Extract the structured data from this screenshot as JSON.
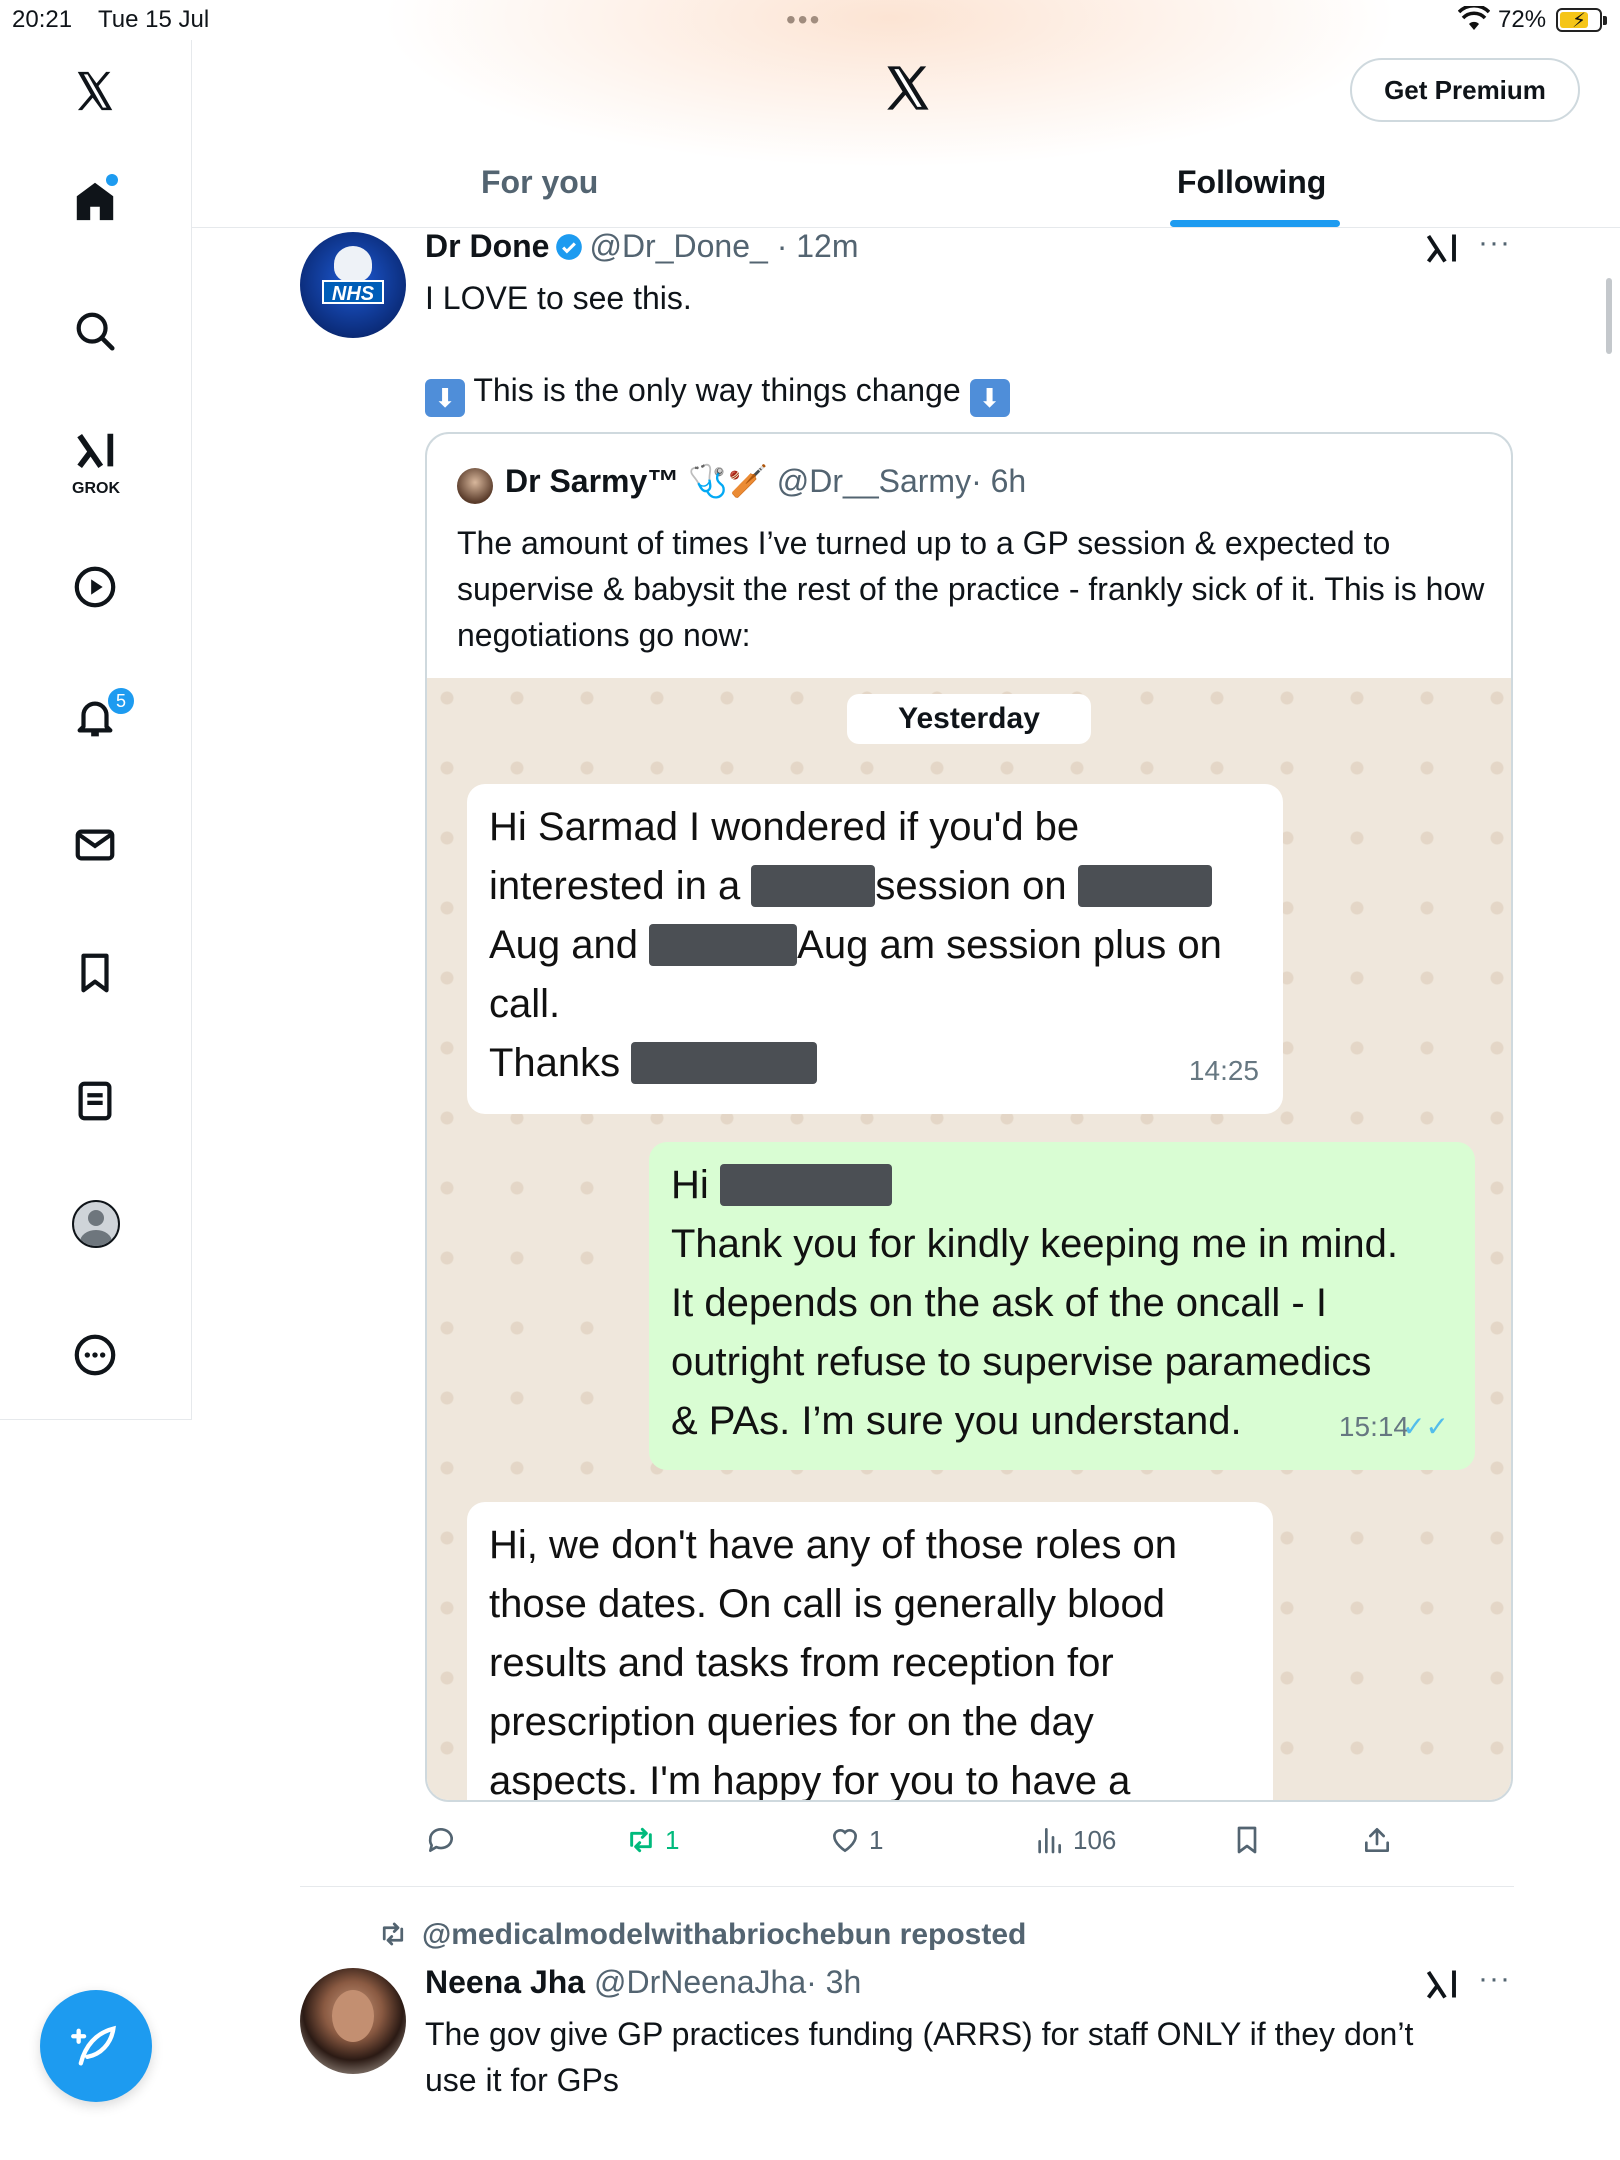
{
  "status_bar": {
    "time": "20:21",
    "date": "Tue 15 Jul",
    "battery": "72%"
  },
  "header": {
    "get_premium": "Get Premium",
    "tabs": [
      "For you",
      "Following"
    ],
    "active_tab": "Following"
  },
  "sidebar": {
    "items": [
      "home-icon",
      "search-icon",
      "grok-icon",
      "video-icon",
      "bell-icon",
      "mail-icon",
      "bookmark-icon",
      "lists-icon",
      "profile-icon",
      "more-icon"
    ],
    "grok_label": "GROK",
    "notification_count": "5"
  },
  "tweet1": {
    "name": "Dr Done",
    "handle": "@Dr_Done_",
    "time": "· 12m",
    "line1": "I LOVE to see this.",
    "line2": "This is the only way things change",
    "quote": {
      "name": "Dr Sarmy™",
      "emoji": "🩺🏏",
      "handle": "@Dr__Sarmy",
      "time": "· 6h",
      "text": "The amount of times I’ve turned up to a GP session & expected to supervise & babysit the rest of the practice - frankly sick of it. This is how negotiations go now:",
      "chat": {
        "date_label": "Yesterday",
        "msg1": {
          "l1": "Hi Sarmad I wondered if you'd be",
          "l2a": "interested in a",
          "l2b": "session on",
          "l3a": "Aug and",
          "l3b": "Aug am session plus on",
          "l4": "call.",
          "l5": "Thanks",
          "time": "14:25"
        },
        "msg2": {
          "l1": "Hi",
          "l2": "Thank you for kindly keeping me in mind.",
          "l3": "It depends on the ask of the oncall - I",
          "l4": "outright refuse to supervise paramedics",
          "l5": "& PAs. I’m sure you understand.",
          "time": "15:14",
          "ticks": "✓✓"
        },
        "msg3": {
          "l1": "Hi, we don't have any of those roles on",
          "l2": "those dates. On call is generally blood",
          "l3": "results and tasks from reception for",
          "l4": "prescription queries for on the day",
          "l5": "aspects. I'm happy for you to have a"
        }
      }
    },
    "actions": {
      "retweets": "1",
      "likes": "1",
      "views": "106"
    }
  },
  "tweet2": {
    "reposted_by": "@medicalmodelwithabriochebun reposted",
    "name": "Neena Jha",
    "handle": "@DrNeenaJha",
    "time": "· 3h",
    "line1": "The gov give GP practices funding (ARRS) for staff ONLY if they don’t",
    "line2": "use it for GPs"
  },
  "colors": {
    "accent": "#1d9bf0",
    "retweet_green": "#00ba7c",
    "chat_bg": "#efe7dc",
    "outgoing_bubble": "#d9fdd3"
  }
}
